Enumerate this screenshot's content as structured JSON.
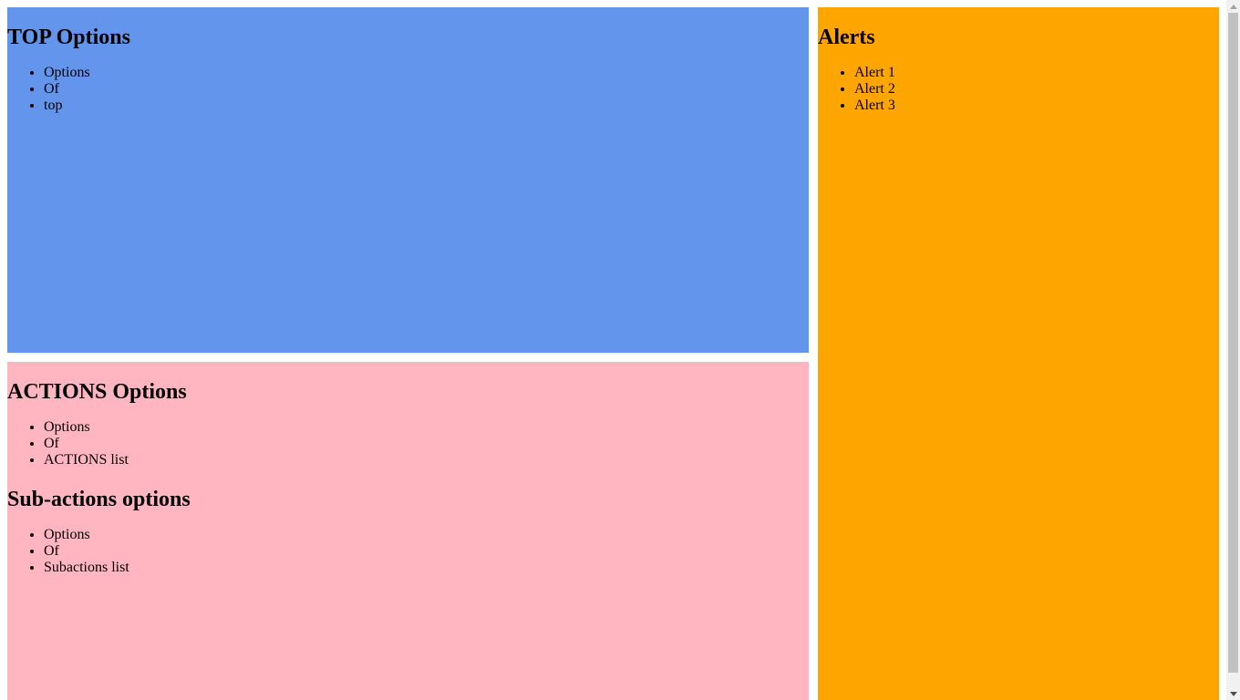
{
  "colors": {
    "top_panel": "#6495ED",
    "actions_panel": "#FFB6C1",
    "alerts_panel": "#FFA500"
  },
  "top": {
    "title": "TOP Options",
    "items": [
      "Options",
      "Of",
      "top"
    ]
  },
  "actions": {
    "title": "ACTIONS Options",
    "items": [
      "Options",
      "Of",
      "ACTIONS list"
    ],
    "sub_title": "Sub-actions options",
    "sub_items": [
      "Options",
      "Of",
      "Subactions list"
    ]
  },
  "alerts": {
    "title": "Alerts",
    "items": [
      "Alert 1",
      "Alert 2",
      "Alert 3"
    ]
  }
}
